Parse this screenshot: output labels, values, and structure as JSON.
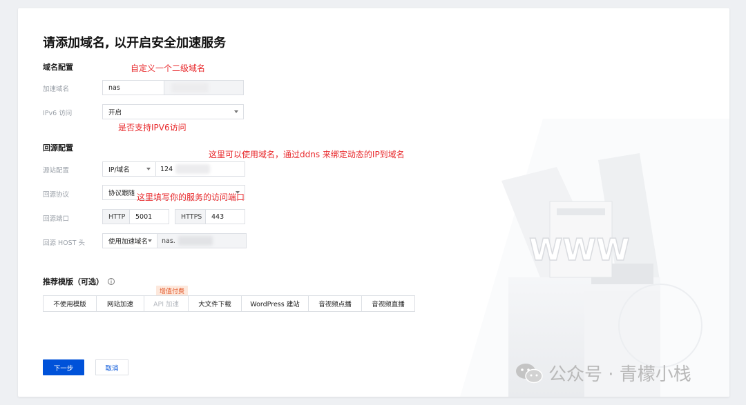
{
  "page": {
    "title": "请添加域名, 以开启安全加速服务"
  },
  "domain_section": {
    "heading": "域名配置",
    "accel_domain_label": "加速域名",
    "accel_domain_value": "nas",
    "ipv6_label": "IPv6 访问",
    "ipv6_value": "开启"
  },
  "origin_section": {
    "heading": "回源配置",
    "source_label": "源站配置",
    "source_type": "IP/域名",
    "source_value": "124",
    "protocol_label": "回源协议",
    "protocol_value": "协议跟随",
    "port_label": "回源端口",
    "http_label": "HTTP",
    "http_port": "5001",
    "https_label": "HTTPS",
    "https_port": "443",
    "host_label": "回源 HOST 头",
    "host_type": "使用加速域名",
    "host_value": "nas."
  },
  "templates": {
    "heading": "推荐模版（可选）",
    "paid_badge": "增值付费",
    "items": [
      "不使用模版",
      "网站加速",
      "API 加速",
      "大文件下载",
      "WordPress 建站",
      "音视频点播",
      "音视频直播"
    ]
  },
  "buttons": {
    "next": "下一步",
    "cancel": "取消"
  },
  "annotations": {
    "subdomain": "自定义一个二级域名",
    "ipv6": "是否支持IPV6访问",
    "ddns": "这里可以使用域名，通过ddns 来绑定动态的IP到域名",
    "port": "这里填写你的服务的访问端口"
  },
  "illustration": {
    "text": "WWW"
  },
  "watermark": {
    "text": "公众号 · 青檬小栈"
  },
  "colors": {
    "primary": "#0052d9",
    "annotation": "#e8282b",
    "badge_bg": "#fde8dc"
  }
}
